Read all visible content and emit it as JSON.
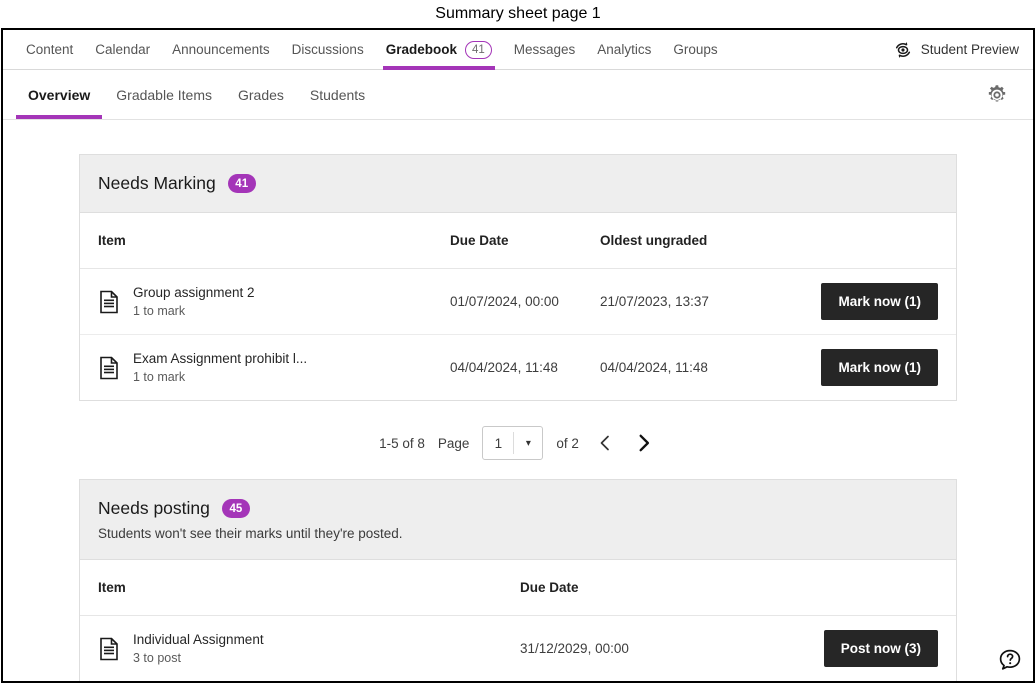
{
  "caption": "Summary sheet page 1",
  "course_nav": {
    "tabs": [
      {
        "label": "Content",
        "badge": null,
        "active": false
      },
      {
        "label": "Calendar",
        "badge": null,
        "active": false
      },
      {
        "label": "Announcements",
        "badge": null,
        "active": false
      },
      {
        "label": "Discussions",
        "badge": null,
        "active": false
      },
      {
        "label": "Gradebook",
        "badge": "41",
        "active": true
      },
      {
        "label": "Messages",
        "badge": null,
        "active": false
      },
      {
        "label": "Analytics",
        "badge": null,
        "active": false
      },
      {
        "label": "Groups",
        "badge": null,
        "active": false
      }
    ],
    "student_preview_label": "Student Preview",
    "student_preview_icon": "student-preview-eye-icon"
  },
  "sub_nav": {
    "tabs": [
      {
        "label": "Overview",
        "active": true
      },
      {
        "label": "Gradable Items",
        "active": false
      },
      {
        "label": "Grades",
        "active": false
      },
      {
        "label": "Students",
        "active": false
      }
    ],
    "settings_icon": "gear-icon"
  },
  "needs_marking": {
    "title": "Needs Marking",
    "badge": "41",
    "columns": [
      "Item",
      "Due Date",
      "Oldest ungraded"
    ],
    "rows": [
      {
        "icon": "document-icon",
        "name": "Group assignment 2",
        "sub": "1 to mark",
        "due_date": "01/07/2024, 00:00",
        "oldest_ungraded": "21/07/2023, 13:37",
        "action": "Mark now (1)"
      },
      {
        "icon": "document-icon",
        "name": "Exam Assignment prohibit l...",
        "sub": "1 to mark",
        "due_date": "04/04/2024, 11:48",
        "oldest_ungraded": "04/04/2024, 11:48",
        "action": "Mark now (1)"
      }
    ]
  },
  "pager": {
    "range": "1-5 of 8",
    "page_label": "Page",
    "current_page": "1",
    "caret": "▾",
    "of_label": "of 2",
    "prev": "‹",
    "next": "›"
  },
  "needs_posting": {
    "title": "Needs posting",
    "badge": "45",
    "subtitle": "Students won't see their marks until they're posted.",
    "columns": [
      "Item",
      "Due Date"
    ],
    "rows": [
      {
        "icon": "document-icon",
        "name": "Individual Assignment",
        "sub": "3 to post",
        "due_date": "31/12/2029, 00:00",
        "action": "Post now (3)"
      }
    ]
  },
  "help": {
    "icon": "help-question-bubble-icon"
  },
  "colors": {
    "accent": "#a435b8",
    "button": "#262626",
    "card_header": "#eeeeee",
    "border": "#dedede"
  }
}
